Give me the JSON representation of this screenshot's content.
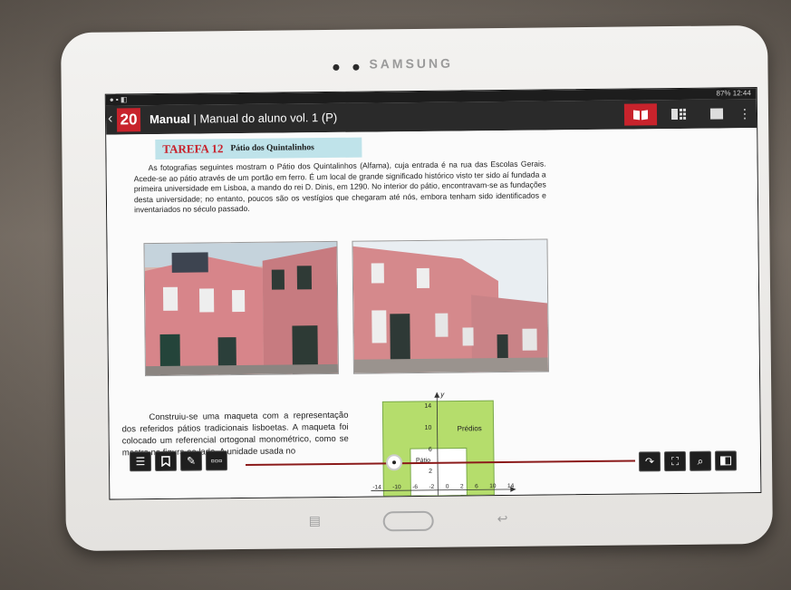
{
  "device": {
    "brand": "SAMSUNG"
  },
  "status_bar": {
    "time": "12:44",
    "battery": "87%"
  },
  "app_bar": {
    "logo_text": "20",
    "title_bold": "Manual",
    "separator": " | ",
    "title_rest": "Manual do aluno vol. 1 (P)",
    "icons": [
      "book-icon",
      "grid-icon",
      "single-page-icon",
      "more-icon"
    ]
  },
  "task": {
    "number": "TAREFA 12",
    "name": "Pátio dos Quintalinhos",
    "intro": "As fotografias seguintes mostram o Pátio dos Quintalinhos (Alfama), cuja entrada é na rua das Escolas Gerais. Acede-se ao pátio através de um portão em ferro. É um local de grande significado histórico visto ter sido aí fundada a primeira universidade em Lisboa, a mando do rei D. Dinis, em 1290. No interior do pátio, encontravam-se as fundações desta universidade; no entanto, poucos são os vestígios que chegaram até nós, embora tenham sido identificados e inventariados no século passado.",
    "para2": "Construiu-se uma maqueta com a representação dos referidos pátios tradicionais lisboetas. A maqueta foi colocado um referencial ortogonal monométrico, como se mostra na figura ao lado. A unidade usada no"
  },
  "figure": {
    "label_buildings": "Prédios",
    "label_patio": "Pátio",
    "y_axis_label": "y",
    "y_ticks": [
      "14",
      "10",
      "6",
      "2"
    ],
    "x_ticks": [
      "-14",
      "-10",
      "-6",
      "-2",
      "0",
      "2",
      "6",
      "10",
      "14"
    ]
  },
  "colors": {
    "accent": "#c8232c",
    "appbar": "#2a2a2a",
    "task_tag": "#bfe3ea",
    "figure_green": "#b5dd6c",
    "progress": "#8b1a1a"
  },
  "toolbar_left": [
    "list-icon",
    "bookmark-icon",
    "pen-icon",
    "dots-icon"
  ],
  "toolbar_right": [
    "redo-arrow-icon",
    "fullscreen-icon",
    "zoom-icon",
    "panel-icon"
  ],
  "hardware_buttons": [
    "menu-icon",
    "home-button",
    "back-icon"
  ]
}
